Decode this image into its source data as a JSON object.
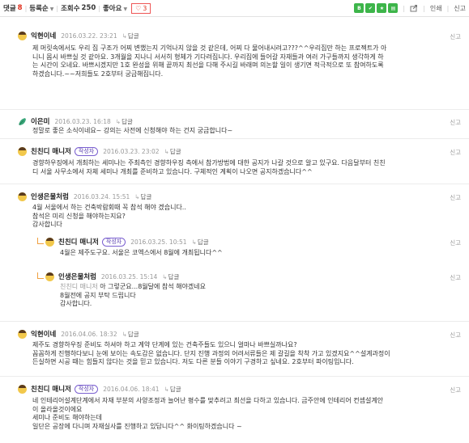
{
  "toolbar": {
    "comments_label": "댓글",
    "comments_count": "8",
    "sort_label": "등록순",
    "views_label": "조회수",
    "views_count": "250",
    "like_label": "좋아요",
    "like_count": "3",
    "print_label": "인쇄",
    "report_label": "신고",
    "share_icon_colors": [
      "#3db54a",
      "#3db54a",
      "#3db54a",
      "#3db54a"
    ]
  },
  "reply_label": "답글",
  "report_label": "신고",
  "author_badge": "작성자",
  "comments": [
    {
      "author": "익현이네",
      "date": "2016.03.22. 23:21",
      "lines": [
        "제 머릿속에서도 우리 집 구조가 어찌 변했는지 기억나지 않을 것 같은데, 어찌 다 물어내시려고???^^우리집만 하는 프로젝트가 아",
        "니니 몹시 바쁘실 것 같아요. 3개월을 지나니 서서히 형체가 기다려집니다. 우리집에 들어갈 자재들과 여러 가구들까지 생각하게 하",
        "는 시간이 오네요. 바쁘시겠지만 1호 완성을 위해 끝까지 최선을 다해 주시길 바래며 의논할 일이 생기면 적극적으로 또 참여하도록",
        "하겠습니다.~~저희들도 2호부터 궁금해집니다."
      ]
    },
    {
      "author": "이은미",
      "date": "2016.03.23. 16:18",
      "lines": [
        "정말로 좋은 소식이네요~ 강의는 사전에 신청해야 하는 건지 궁금합니다~"
      ]
    },
    {
      "author": "친친디 매니저",
      "date": "2016.03.23. 23:02",
      "lines": [
        "경향하우징에서 개최하는 세미나는 주최측인 경향하우징 측에서 참가방법에 대한 공지가 나갈 것으로 알고 있구요. 다음달부터 친친",
        "디 서울 사무소에서 자체 세미나 개최를 준비하고 있습니다. 구체적인 계획이 나오면 공지하겠습니다^^"
      ]
    },
    {
      "author": "인생은물처럼",
      "date": "2016.03.24. 15:51",
      "lines": [
        "4월 서울에서 하는 건축박람회때 꼭 참석 해야 겠습니다..",
        "참석은 미리 신청을 해야하는지요?",
        "감사합니다"
      ]
    },
    {
      "author": "친친디 매니저",
      "date": "2016.03.25. 10:51",
      "lines": [
        "4월은 제주도구요. 서울은 코엑스에서 8월에 개최됩니다^^"
      ]
    },
    {
      "author": "인생은물처럼",
      "date": "2016.03.25. 15:14",
      "ref": "친친디 매니저",
      "lines": [
        "아 그렇군요...8월달에 참석 해야겠네요",
        "8월전에 공지 부탁 드립니다",
        "감사합니다."
      ]
    },
    {
      "author": "익현이네",
      "date": "2016.04.06. 18:32",
      "lines": [
        "제주도 경향하우징 준비도 하셔야 하고 계약 단계에 있는 건축주들도 있으니 얼마나 바쁘실까나요?",
        "꼼꼼하게 진행하다보니 눈에 보이는 속도감은 없습니다. 단지 진행 과정의 어려서류들은 제 갈길을 착착 가고 있겠지요^^설계과정이",
        "든실하면 시공 때는 힘들지 않다는 것을 믿고 있습니다. 저도 다른 분들 이야기 구경하고 싶네요. 2호부터 파이팅입니다."
      ]
    },
    {
      "author": "친친디 매니저",
      "date": "2016.04.06. 18:41",
      "lines": [
        "네 인테리어설계단계에서 자재 부분의 사양조정과 늘어난 평수를 맞추려고 최선을 다하고 있습니다. 금주안에 인테리어 컨셉설계안",
        "이 올라올것이에요",
        "세미나 준비도 해야하는데",
        "일단은 공장에 다니며 자재실사를 진행하고 있답니다^^ 화이팅하겠습니다 ~"
      ]
    }
  ]
}
